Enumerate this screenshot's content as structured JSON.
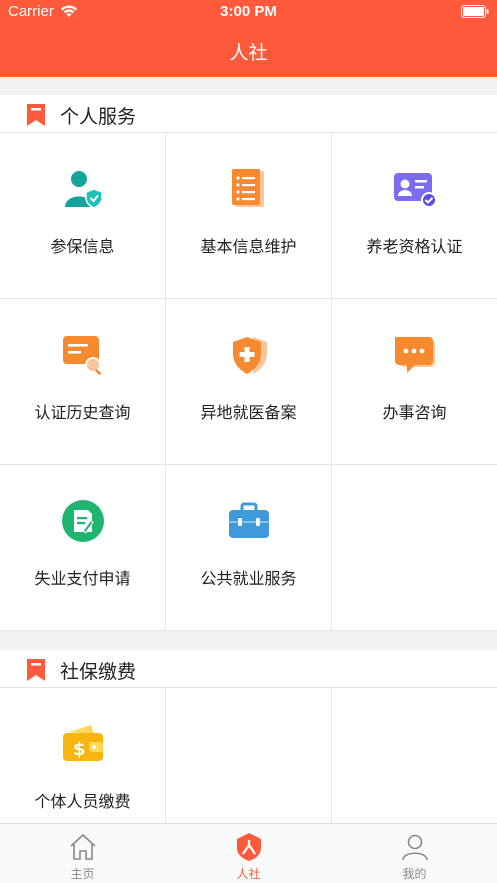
{
  "status_bar": {
    "carrier": "Carrier",
    "time": "3:00 PM"
  },
  "nav": {
    "title": "人社"
  },
  "sections": [
    {
      "title": "个人服务",
      "items": [
        {
          "label": "参保信息",
          "icon": "insured-person-icon"
        },
        {
          "label": "基本信息维护",
          "icon": "document-list-icon"
        },
        {
          "label": "养老资格认证",
          "icon": "id-card-check-icon"
        },
        {
          "label": "认证历史查询",
          "icon": "search-record-icon"
        },
        {
          "label": "异地就医备案",
          "icon": "medical-shield-icon"
        },
        {
          "label": "办事咨询",
          "icon": "chat-bubble-icon"
        },
        {
          "label": "失业支付申请",
          "icon": "application-form-icon"
        },
        {
          "label": "公共就业服务",
          "icon": "briefcase-icon"
        }
      ]
    },
    {
      "title": "社保缴费",
      "items": [
        {
          "label": "个体人员缴费",
          "icon": "wallet-dollar-icon"
        }
      ]
    }
  ],
  "tabbar": {
    "items": [
      {
        "label": "主页",
        "icon": "home-icon",
        "active": false
      },
      {
        "label": "人社",
        "icon": "social-security-icon",
        "active": true
      },
      {
        "label": "我的",
        "icon": "user-icon",
        "active": false
      }
    ]
  },
  "colors": {
    "accent": "#ff5a3c",
    "background": "#f2f2f2"
  }
}
